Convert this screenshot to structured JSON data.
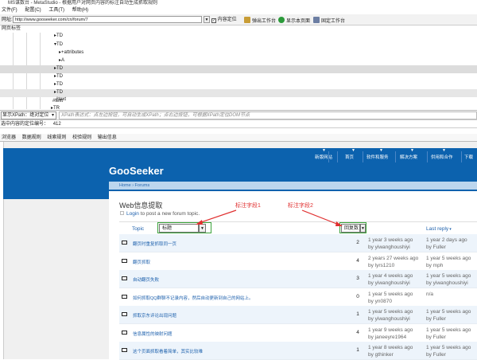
{
  "app": {
    "title": "MS谋数台 - MetaStudio - 根据用户对网页内容的标注自动生成抓取规则",
    "menu": [
      "文件(F)",
      "配置(C)",
      "工具(T)",
      "帮助(H)"
    ]
  },
  "toolbar": {
    "url_label": "网址:",
    "url_value": "http://www.gooseeker.com/cn/forum/7",
    "url_arrow": "▼",
    "content_locate": "内容定位",
    "pop_workbench": "弹出工作台",
    "show_page": "显示本页面",
    "pin_workbench": "固定工作台"
  },
  "tree": {
    "header": "网页标签",
    "rows": [
      "TD",
      "TD",
      "+attributes",
      "A",
      "TD",
      "TD",
      "TD",
      "TD",
      "#text",
      "#text",
      "TR"
    ]
  },
  "xpath": {
    "select": "显示XPath：绝对定位",
    "placeholder": "XPath表达式：点左边按钮，可自动生成XPath；点右边按钮，可根据XPath定位DOM节点"
  },
  "locate_line": {
    "label": "选中内容的定位编号：",
    "value": "412"
  },
  "bottom_tabs": [
    "浏览器",
    "数据规则",
    "线索规则",
    "校验规则",
    "输出信息"
  ],
  "site": {
    "nav": [
      "新版网站",
      "首页",
      "软件和服务",
      "解决方案",
      "供用和合作",
      "下载"
    ],
    "logo": "GooSeeker",
    "breadcrumb": "Home › Forums",
    "page_title": "Web信息提取",
    "login_link": "Login",
    "login_rest": " to post a new forum topic.",
    "col_topic": "Topic",
    "col_last_reply": "Last reply"
  },
  "annotations": {
    "field1_label": "标注字段1",
    "field2_label": "标注字段2",
    "field1_value": "标题",
    "field2_value": "回复数",
    "arrow": "▼"
  },
  "topics": [
    {
      "title": "翻页时重复抓取同一页",
      "replies": "2",
      "created": "1 year 3 weeks ago",
      "author": "by yiwanghoushiyi",
      "last": "1 year 2 days ago",
      "last_by": "by Fuller"
    },
    {
      "title": "翻页抓取",
      "replies": "4",
      "created": "2 years 27 weeks ago",
      "author": "by lyrs1210",
      "last": "1 year 5 weeks ago",
      "last_by": "by mph"
    },
    {
      "title": "自动翻页失败",
      "replies": "3",
      "created": "1 year 4 weeks ago",
      "author": "by yiwanghoushiyi",
      "last": "1 year 5 weeks ago",
      "last_by": "by yiwanghoushiyi"
    },
    {
      "title": "如何抓取QQ群聊不记录内容，然后自动更新到自己的网站上。",
      "replies": "0",
      "created": "1 year 5 weeks ago",
      "author": "by yn0870",
      "last": "n/a",
      "last_by": ""
    },
    {
      "title": "抓取京东评论出现问题",
      "replies": "1",
      "created": "1 year 5 weeks ago",
      "author": "by yiwanghoushiyi",
      "last": "1 year 5 weeks ago",
      "last_by": "by Fuller"
    },
    {
      "title": "信息属性的映射问题",
      "replies": "4",
      "created": "1 year 9 weeks ago",
      "author": "by janeeyre1964",
      "last": "1 year 5 weeks ago",
      "last_by": "by Fuller"
    },
    {
      "title": "这个页面抓取看着简单，其实比较难",
      "replies": "1",
      "created": "1 year 8 weeks ago",
      "author": "by gthinker",
      "last": "1 year 5 weeks ago",
      "last_by": "by Fuller"
    }
  ],
  "colors": {
    "site_header": "#0c62ae",
    "link": "#1e61ad",
    "highlight": "#f8f49a",
    "annotation": "#e03030"
  }
}
